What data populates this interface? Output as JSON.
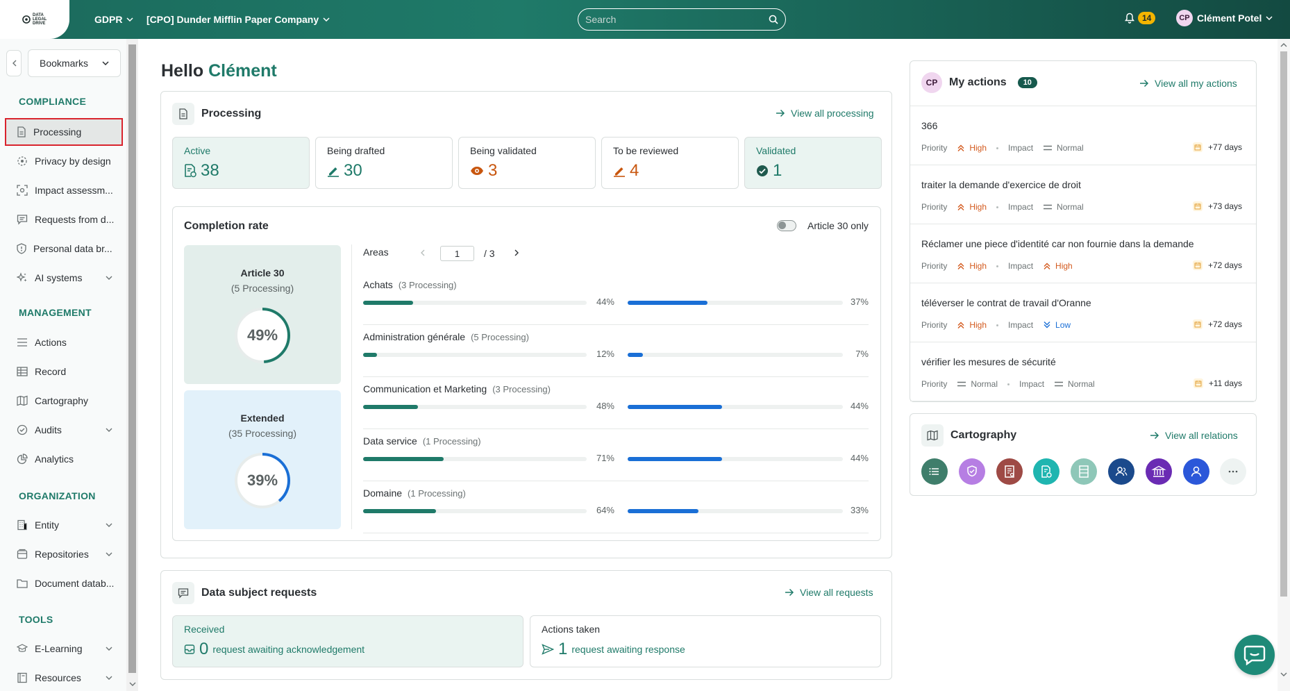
{
  "topbar": {
    "logo_text": "DATA LEGAL DRIVE",
    "module": "GDPR",
    "company": "[CPO] Dunder Mifflin Paper Company",
    "search_placeholder": "Search",
    "notifications": "14",
    "user_initials": "CP",
    "user_name": "Clément Potel"
  },
  "sidebar": {
    "bookmarks": "Bookmarks",
    "sections": {
      "compliance": "COMPLIANCE",
      "management": "MANAGEMENT",
      "organization": "ORGANIZATION",
      "tools": "TOOLS"
    },
    "items": {
      "processing": "Processing",
      "privacy": "Privacy by design",
      "impact": "Impact assessm...",
      "requests": "Requests from d...",
      "breach": "Personal data br...",
      "ai": "AI systems",
      "actions": "Actions",
      "record": "Record",
      "cartography": "Cartography",
      "audits": "Audits",
      "analytics": "Analytics",
      "entity": "Entity",
      "repositories": "Repositories",
      "docdb": "Document datab...",
      "elearning": "E-Learning",
      "resources": "Resources"
    }
  },
  "greeting": {
    "hello": "Hello",
    "name": "Clément"
  },
  "processing": {
    "title": "Processing",
    "link": "View all processing",
    "stats": [
      {
        "label": "Active",
        "value": "38",
        "color": "#1f7a69"
      },
      {
        "label": "Being drafted",
        "value": "30",
        "color": "#1f7a69"
      },
      {
        "label": "Being validated",
        "value": "3",
        "color": "#c8560e"
      },
      {
        "label": "To be reviewed",
        "value": "4",
        "color": "#c8560e"
      },
      {
        "label": "Validated",
        "value": "1",
        "color": "#1f7a69"
      }
    ]
  },
  "completion": {
    "title": "Completion rate",
    "toggle_label": "Article 30 only",
    "article30": {
      "title": "Article 30",
      "sub": "(5 Processing)",
      "pct": "49%",
      "value": 49
    },
    "extended": {
      "title": "Extended",
      "sub": "(35 Processing)",
      "pct": "39%",
      "value": 39
    },
    "areas_label": "Areas",
    "page": "1",
    "page_total": "/ 3",
    "areas": [
      {
        "name": "Achats",
        "count": "(3 Processing)",
        "a": 44,
        "a_label": "44%",
        "b": 37,
        "b_label": "37%"
      },
      {
        "name": "Administration générale",
        "count": "(5 Processing)",
        "a": 12,
        "a_label": "12%",
        "b": 7,
        "b_label": "7%"
      },
      {
        "name": "Communication et Marketing",
        "count": "(3 Processing)",
        "a": 48,
        "a_label": "48%",
        "b": 44,
        "b_label": "44%"
      },
      {
        "name": "Data service",
        "count": "(1 Processing)",
        "a": 71,
        "a_label": "71%",
        "b": 44,
        "b_label": "44%"
      },
      {
        "name": "Domaine",
        "count": "(1 Processing)",
        "a": 64,
        "a_label": "64%",
        "b": 33,
        "b_label": "33%"
      }
    ]
  },
  "requests": {
    "title": "Data subject requests",
    "link": "View all requests",
    "received": {
      "label": "Received",
      "value": "0",
      "text": "request awaiting acknowledgement"
    },
    "actions": {
      "label": "Actions taken",
      "value": "1",
      "text": "request awaiting response"
    }
  },
  "my_actions": {
    "initials": "CP",
    "title": "My actions",
    "count": "10",
    "link": "View all my actions",
    "priority_label": "Priority",
    "impact_label": "Impact",
    "items": [
      {
        "title": "366",
        "priority": "High",
        "impact": "Normal",
        "days": "+77 days"
      },
      {
        "title": "traiter la demande d'exercice de droit",
        "priority": "High",
        "impact": "Normal",
        "days": "+73 days"
      },
      {
        "title": "Réclamer une piece d'identité car non fournie dans la demande",
        "priority": "High",
        "impact": "High",
        "days": "+72 days"
      },
      {
        "title": "téléverser le contrat de travail d'Oranne",
        "priority": "High",
        "impact": "Low",
        "days": "+72 days"
      },
      {
        "title": "vérifier les mesures de sécurité",
        "priority": "Normal",
        "impact": "Normal",
        "days": "+11 days"
      }
    ]
  },
  "cartography": {
    "title": "Cartography",
    "link": "View all relations",
    "icons": [
      {
        "name": "list-icon",
        "color": "#3f7e6b"
      },
      {
        "name": "shield-check-icon",
        "color": "#b67ee3"
      },
      {
        "name": "document-icon",
        "color": "#9e4a45"
      },
      {
        "name": "processing-icon",
        "color": "#1fb5b0"
      },
      {
        "name": "table-icon",
        "color": "#8ec7b8"
      },
      {
        "name": "people-icon",
        "color": "#1b4a8c"
      },
      {
        "name": "bank-icon",
        "color": "#6a2bb3"
      },
      {
        "name": "person-icon",
        "color": "#2b57d9"
      },
      {
        "name": "more-icon",
        "color": "#eef3f2"
      }
    ]
  }
}
